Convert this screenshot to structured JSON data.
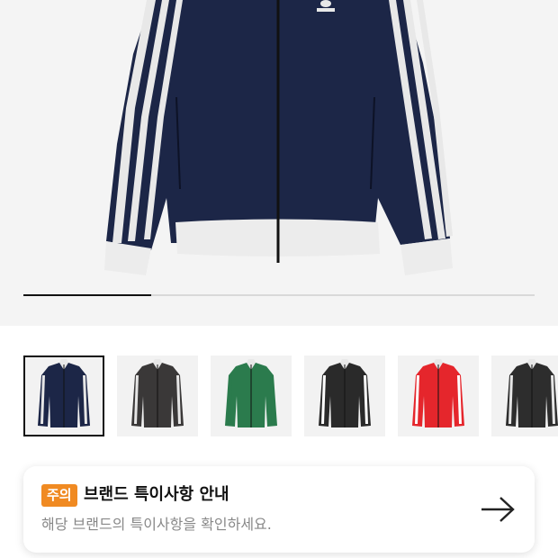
{
  "product": {
    "image_alt": "adidas track jacket navy",
    "brand_logo_text": "adidas"
  },
  "gallery": {
    "progress": 0.25,
    "thumbnails": [
      {
        "color_name": "navy",
        "body": "#1c2647",
        "stripe": "#e6e6e6",
        "selected": true
      },
      {
        "color_name": "charcoal",
        "body": "#3a3838",
        "stripe": "#e6e6e6",
        "selected": false
      },
      {
        "color_name": "green",
        "body": "#2b7b4d",
        "stripe": "#2b7b4d",
        "selected": false
      },
      {
        "color_name": "black",
        "body": "#2a2a2a",
        "stripe": "#ffffff",
        "selected": false
      },
      {
        "color_name": "red",
        "body": "#e5262c",
        "stripe": "#ffffff",
        "selected": false
      },
      {
        "color_name": "black-2",
        "body": "#2d2d2d",
        "stripe": "#e6e6e6",
        "selected": false
      }
    ]
  },
  "notice": {
    "badge": "주의",
    "title": "브랜드 특이사항 안내",
    "description": "해당 브랜드의 특이사항을 확인하세요."
  },
  "colors": {
    "badge_bg": "#f08a22",
    "navy": "#1c2647"
  },
  "icons": {
    "arrow": "arrow-right-icon"
  }
}
